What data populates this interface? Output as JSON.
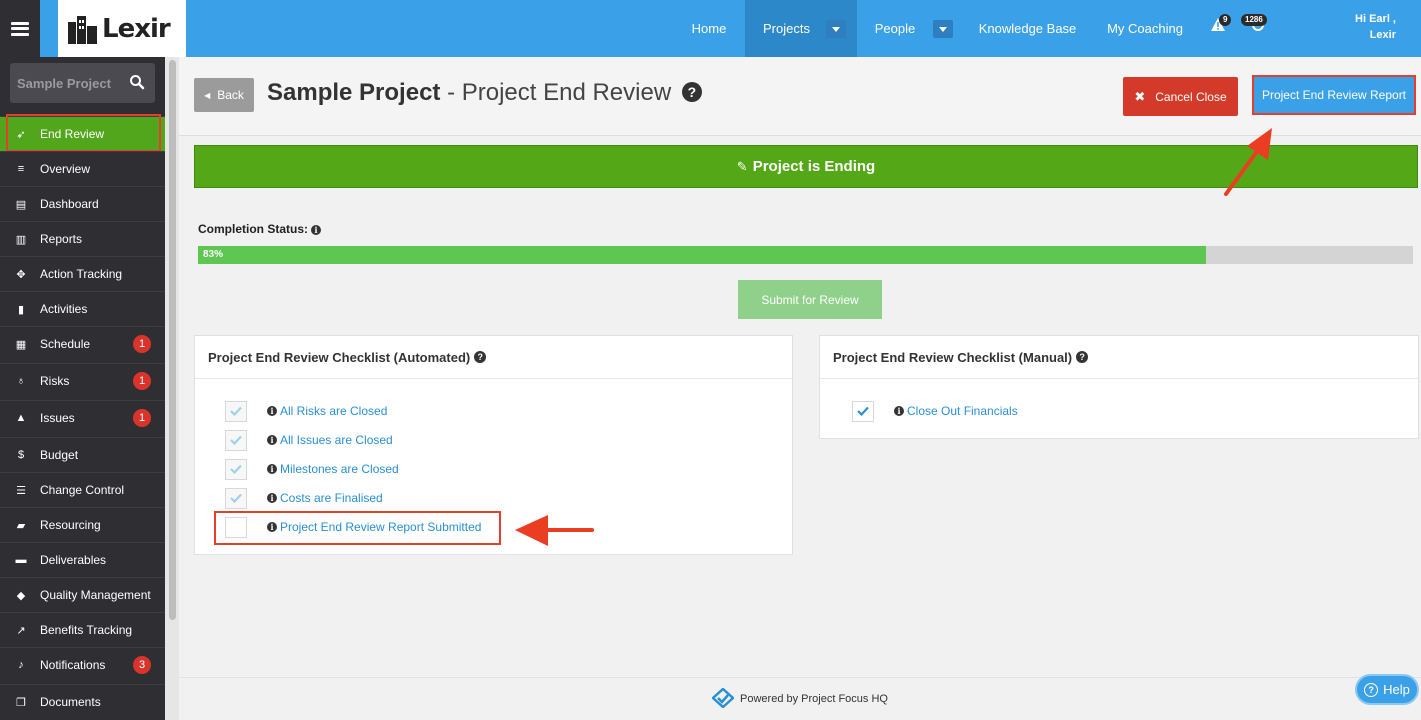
{
  "topbar": {
    "logo": "Lexir",
    "nav": [
      {
        "label": "Home"
      },
      {
        "label": "Projects"
      },
      {
        "label": "People"
      },
      {
        "label": "Knowledge Base"
      },
      {
        "label": "My Coaching"
      }
    ],
    "alerts_count": "9",
    "messages_count": "1286",
    "greeting_line1": "Hi Earl ,",
    "greeting_line2": "Lexir"
  },
  "sidebar": {
    "search_text": "Sample Project",
    "items": [
      {
        "label": "End Review",
        "icon": "rocket-icon"
      },
      {
        "label": "Overview",
        "icon": "align-left-icon"
      },
      {
        "label": "Dashboard",
        "icon": "dashboard-icon"
      },
      {
        "label": "Reports",
        "icon": "bar-chart-icon"
      },
      {
        "label": "Action Tracking",
        "icon": "crosshair-icon"
      },
      {
        "label": "Activities",
        "icon": "bookmark-icon"
      },
      {
        "label": "Schedule",
        "icon": "calendar-icon",
        "badge": "1"
      },
      {
        "label": "Risks",
        "icon": "lightbulb-icon",
        "badge": "1"
      },
      {
        "label": "Issues",
        "icon": "warning-icon",
        "badge": "1"
      },
      {
        "label": "Budget",
        "icon": "dollar-icon"
      },
      {
        "label": "Change Control",
        "icon": "tasks-icon"
      },
      {
        "label": "Resourcing",
        "icon": "folder-open-icon"
      },
      {
        "label": "Deliverables",
        "icon": "truck-icon"
      },
      {
        "label": "Quality Management",
        "icon": "tag-icon"
      },
      {
        "label": "Benefits Tracking",
        "icon": "line-chart-icon"
      },
      {
        "label": "Notifications",
        "icon": "bell-icon",
        "badge": "3"
      },
      {
        "label": "Documents",
        "icon": "documents-icon"
      }
    ]
  },
  "header": {
    "back_label": "Back",
    "title_bold": "Sample Project",
    "title_rest": " - Project End Review",
    "cancel_label": "Cancel Close",
    "report_label": "Project End Review Report"
  },
  "banner": {
    "text": "Project is Ending"
  },
  "completion": {
    "label": "Completion Status:",
    "percent_text": "83%",
    "percent": 83
  },
  "submit_label": "Submit for Review",
  "automated": {
    "title": "Project End Review Checklist (Automated)",
    "items": [
      {
        "label": "All Risks are Closed",
        "checked": true
      },
      {
        "label": "All Issues are Closed",
        "checked": true
      },
      {
        "label": "Milestones are Closed",
        "checked": true
      },
      {
        "label": "Costs are Finalised",
        "checked": true
      },
      {
        "label": "Project End Review Report Submitted",
        "checked": false
      }
    ]
  },
  "manual": {
    "title": "Project End Review Checklist (Manual)",
    "items": [
      {
        "label": "Close Out Financials",
        "checked": true
      }
    ]
  },
  "footer": {
    "text": "Powered by Project Focus HQ"
  },
  "help_label": "Help",
  "colors": {
    "brand_blue": "#3aa0e8",
    "sidebar_dark": "#2e2e33",
    "active_green": "#52a61b",
    "banner_green": "#54a817",
    "progress_green": "#5dc752",
    "danger_red": "#d43a2a",
    "annotation_red": "#e2402a",
    "link_blue": "#2a8fd3"
  }
}
